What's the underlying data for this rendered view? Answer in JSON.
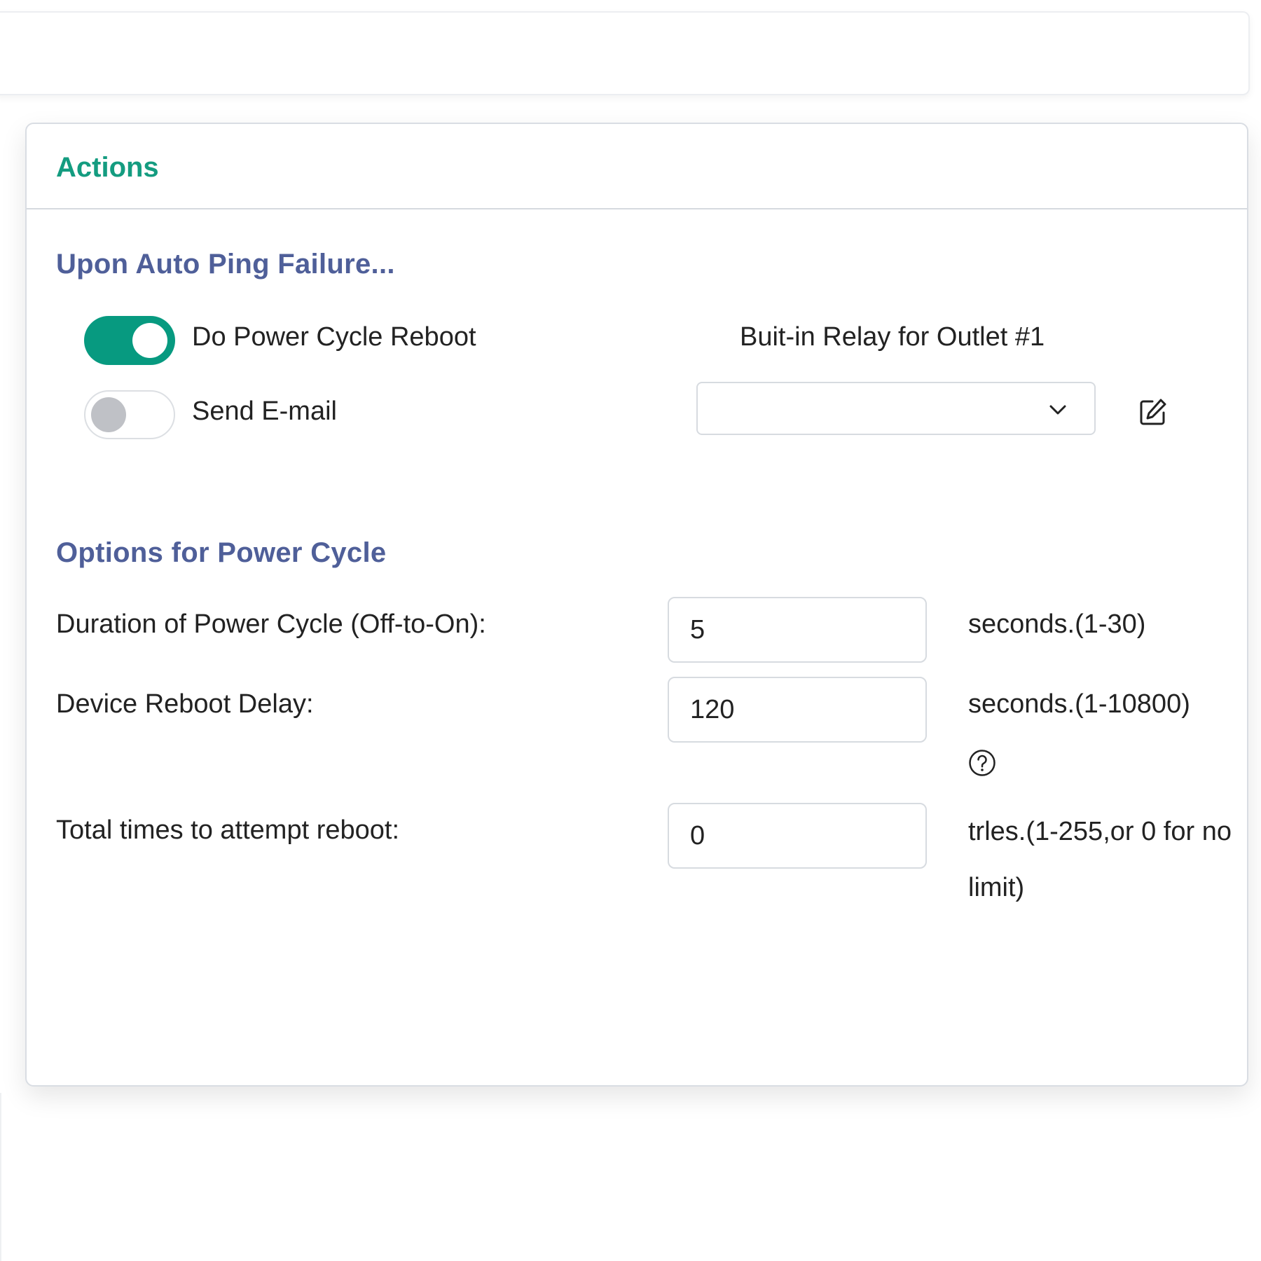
{
  "card": {
    "title": "Actions"
  },
  "ping_failure": {
    "heading": "Upon Auto Ping Failure...",
    "power_cycle_label": "Do Power Cycle Reboot",
    "power_cycle_enabled": true,
    "email_label": "Send E-mail",
    "email_enabled": false,
    "relay_label": "Buit-in Relay for Outlet #1",
    "relay_select_value": ""
  },
  "power_cycle_options": {
    "heading": "Options for Power Cycle",
    "duration_label": "Duration of Power Cycle (Off-to-On):",
    "duration_value": "5",
    "duration_unit": "seconds.(1-30)",
    "reboot_delay_label": "Device Reboot Delay:",
    "reboot_delay_value": "120",
    "reboot_delay_unit": "seconds.(1-10800)",
    "attempts_label": "Total times to attempt reboot:",
    "attempts_value": "0",
    "attempts_unit": "trles.(1-255,or 0 for no limit)"
  },
  "icons": {
    "dropdown": "chevron-down-icon",
    "edit": "edit-icon",
    "help": "help-circle-icon"
  },
  "colors": {
    "accent_teal": "#079a80",
    "title_teal": "#149c80",
    "heading_indigo": "#4f5f99"
  }
}
